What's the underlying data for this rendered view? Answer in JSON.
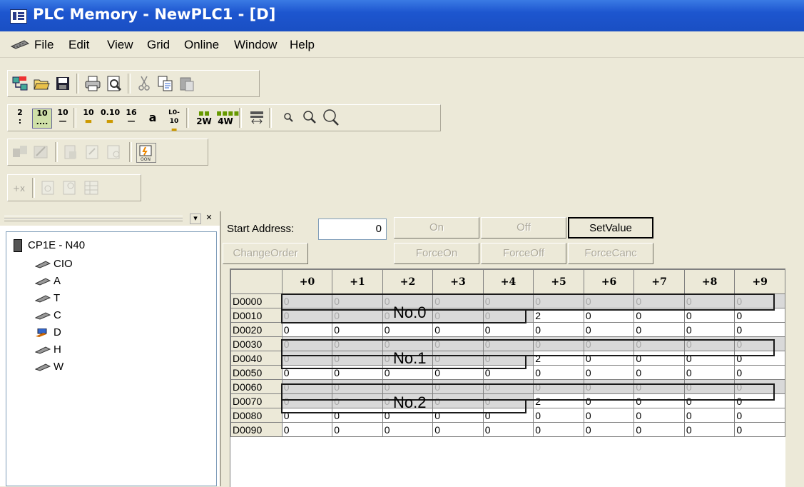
{
  "window": {
    "title": "PLC Memory - NewPLC1 - [D]"
  },
  "menu": [
    "File",
    "Edit",
    "View",
    "Grid",
    "Online",
    "Window",
    "Help"
  ],
  "toolbar_rows": {
    "row1_icons": [
      "new-project-icon",
      "open-folder-icon",
      "save-icon",
      "print-icon",
      "print-preview-icon",
      "cut-icon",
      "copy-icon",
      "paste-icon"
    ],
    "row2_format": [
      "2",
      "10",
      "10",
      "10",
      "0.10",
      "16",
      "a",
      "L0-10",
      "2W",
      "4W"
    ],
    "row4_icons": [
      "transfer-from-plc-icon",
      "compare-icon",
      "monitor-icon",
      "set-icon",
      "reset-icon",
      "online-edit-icon"
    ]
  },
  "tree": {
    "root": "CP1E - N40",
    "items": [
      "CIO",
      "A",
      "T",
      "C",
      "D",
      "H",
      "W"
    ]
  },
  "controls": {
    "start_address_label": "Start Address:",
    "start_address_value": "0",
    "on": "On",
    "off": "Off",
    "set_value": "SetValue",
    "change_order": "ChangeOrder",
    "force_on": "ForceOn",
    "force_off": "ForceOff",
    "force_canc": "ForceCanc"
  },
  "grid": {
    "columns": [
      "+0",
      "+1",
      "+2",
      "+3",
      "+4",
      "+5",
      "+6",
      "+7",
      "+8",
      "+9"
    ],
    "rows": [
      {
        "addr": "D0000",
        "vals": [
          "0",
          "0",
          "0",
          "0",
          "0",
          "0",
          "0",
          "0",
          "0",
          "0"
        ]
      },
      {
        "addr": "D0010",
        "vals": [
          "0",
          "0",
          "0",
          "0",
          "0",
          "2",
          "0",
          "0",
          "0",
          "0"
        ]
      },
      {
        "addr": "D0020",
        "vals": [
          "0",
          "0",
          "0",
          "0",
          "0",
          "0",
          "0",
          "0",
          "0",
          "0"
        ]
      },
      {
        "addr": "D0030",
        "vals": [
          "0",
          "0",
          "0",
          "0",
          "0",
          "0",
          "0",
          "0",
          "0",
          "0"
        ]
      },
      {
        "addr": "D0040",
        "vals": [
          "0",
          "0",
          "0",
          "0",
          "0",
          "2",
          "0",
          "0",
          "0",
          "0"
        ]
      },
      {
        "addr": "D0050",
        "vals": [
          "0",
          "0",
          "0",
          "0",
          "0",
          "0",
          "0",
          "0",
          "0",
          "0"
        ]
      },
      {
        "addr": "D0060",
        "vals": [
          "0",
          "0",
          "0",
          "0",
          "0",
          "0",
          "0",
          "0",
          "0",
          "0"
        ]
      },
      {
        "addr": "D0070",
        "vals": [
          "0",
          "0",
          "0",
          "0",
          "0",
          "2",
          "0",
          "0",
          "0",
          "0"
        ]
      },
      {
        "addr": "D0080",
        "vals": [
          "0",
          "0",
          "0",
          "0",
          "0",
          "0",
          "0",
          "0",
          "0",
          "0"
        ]
      },
      {
        "addr": "D0090",
        "vals": [
          "0",
          "0",
          "0",
          "0",
          "0",
          "0",
          "0",
          "0",
          "0",
          "0"
        ]
      }
    ],
    "annotations": [
      "No.0",
      "No.1",
      "No.2"
    ]
  }
}
